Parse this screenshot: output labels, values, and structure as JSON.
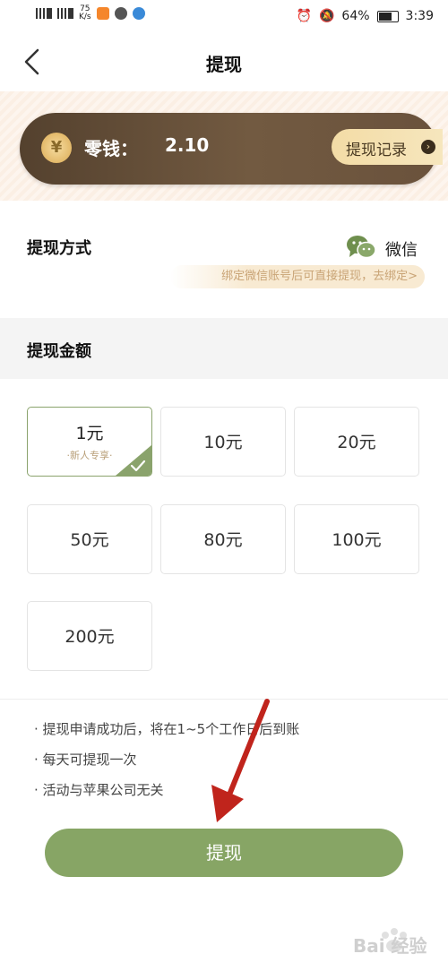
{
  "status_bar": {
    "net_speed_value": "75",
    "net_speed_unit": "K/s",
    "battery": "64%",
    "time": "3:39"
  },
  "nav": {
    "title": "提现"
  },
  "balance": {
    "label": "零钱：",
    "value": "2.10",
    "record_button": "提现记录"
  },
  "method": {
    "title": "提现方式",
    "wechat_label": "微信",
    "bind_hint": "绑定微信账号后可直接提现，去绑定>"
  },
  "amount": {
    "title": "提现金额",
    "options": [
      {
        "value": "1元",
        "sub": "·新人专享·",
        "selected": true
      },
      {
        "value": "10元"
      },
      {
        "value": "20元"
      },
      {
        "value": "50元"
      },
      {
        "value": "80元"
      },
      {
        "value": "100元"
      },
      {
        "value": "200元"
      }
    ]
  },
  "notes": [
    "· 提现申请成功后，将在1~5个工作日后到账",
    "· 每天可提现一次",
    "· 活动与苹果公司无关"
  ],
  "submit_label": "提现",
  "colors": {
    "accent_green": "#87a565",
    "balance_card": "#5c4733",
    "hint_text": "#c9a476",
    "annotation_arrow": "#c0241c"
  },
  "watermark": {
    "text": "Bai 经验"
  }
}
